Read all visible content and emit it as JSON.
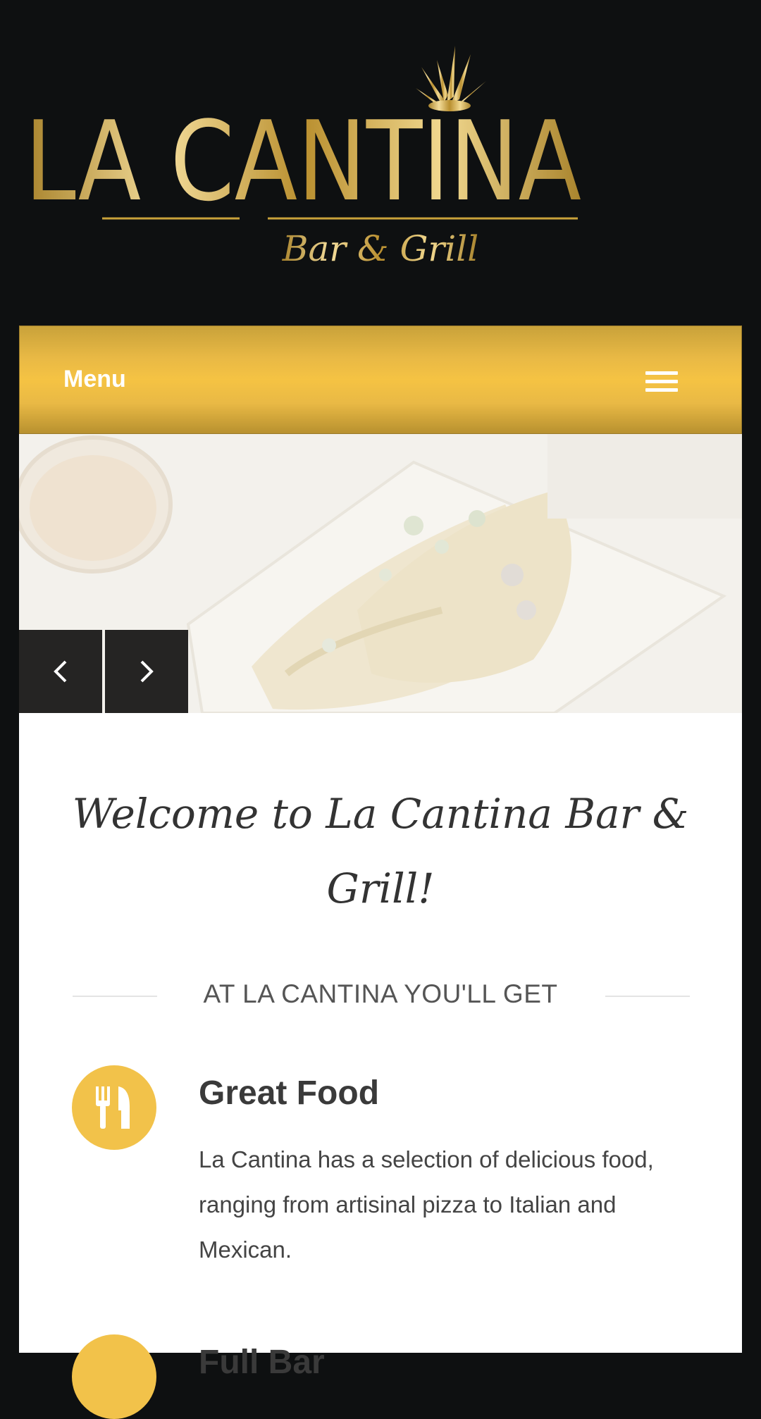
{
  "logo": {
    "title": "LA CANTINA",
    "subtitle": "Bar & Grill",
    "gold": "#c9a23a"
  },
  "nav": {
    "menu_label": "Menu",
    "hamburger_icon": "hamburger-menu-icon",
    "bar_color": "#f5c343"
  },
  "slider": {
    "prev_icon": "chevron-left-icon",
    "next_icon": "chevron-right-icon"
  },
  "main": {
    "welcome": "Welcome to La Cantina Bar & Grill!",
    "section_heading": "AT LA CANTINA YOU'LL GET",
    "features": [
      {
        "icon": "fork-knife-icon",
        "title": "Great Food",
        "text": "La Cantina has a selection of delicious food, ranging from artisinal pizza to Italian and Mexican."
      },
      {
        "icon": "bar-icon",
        "title": "Full Bar"
      }
    ]
  },
  "colors": {
    "page_bg": "#0e1011",
    "accent": "#f2c24a",
    "content_bg": "#ffffff"
  }
}
